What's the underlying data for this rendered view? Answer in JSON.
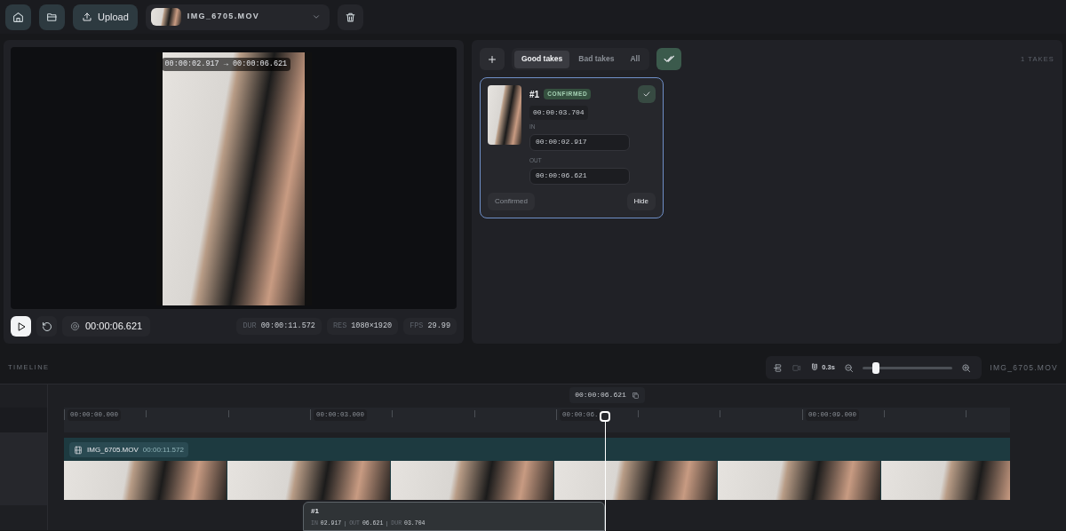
{
  "toolbar": {
    "upload_label": "Upload",
    "file_name": "IMG_6705.MOV"
  },
  "preview": {
    "range_label": "00:00:02.917 → 00:00:06.621",
    "current_time": "00:00:06.621",
    "stats": [
      {
        "label": "DUR",
        "value": "00:00:11.572"
      },
      {
        "label": "RES",
        "value": "1080×1920"
      },
      {
        "label": "FPS",
        "value": "29.99"
      }
    ]
  },
  "takes_panel": {
    "tabs": [
      {
        "label": "Good takes",
        "selected": true
      },
      {
        "label": "Bad takes",
        "selected": false
      },
      {
        "label": "All",
        "selected": false
      }
    ],
    "count": "1 TAKES",
    "takes": [
      {
        "number": "#1",
        "status": "CONFIRMED",
        "selected": true,
        "duration": "00:00:03.704",
        "in_label": "IN",
        "in_value": "00:00:02.917",
        "out_label": "OUT",
        "out_value": "00:00:06.621",
        "confirm_label": "Confirmed",
        "confirm_disabled": true,
        "hide_label": "Hide"
      }
    ]
  },
  "timeline": {
    "title": "TIMELINE",
    "snap": "0.3s",
    "zoom": {
      "level": 0.15
    },
    "file_name": "IMG_6705.MOV",
    "playhead_time": "00:00:06.621",
    "playhead": {
      "level": 0.572
    },
    "ruler": [
      "00:00:00.000",
      "00:00:03.000",
      "00:00:06.",
      "00:00:09.000"
    ],
    "clip": {
      "name": "IMG_6705.MOV",
      "duration": "00:00:11.572"
    },
    "take_clips": [
      {
        "number": "#1",
        "parts": [
          {
            "label": "IN",
            "value": "02.917"
          },
          {
            "label": "OUT",
            "value": "06.621"
          },
          {
            "label": "DUR",
            "value": "03.704"
          }
        ]
      }
    ]
  }
}
